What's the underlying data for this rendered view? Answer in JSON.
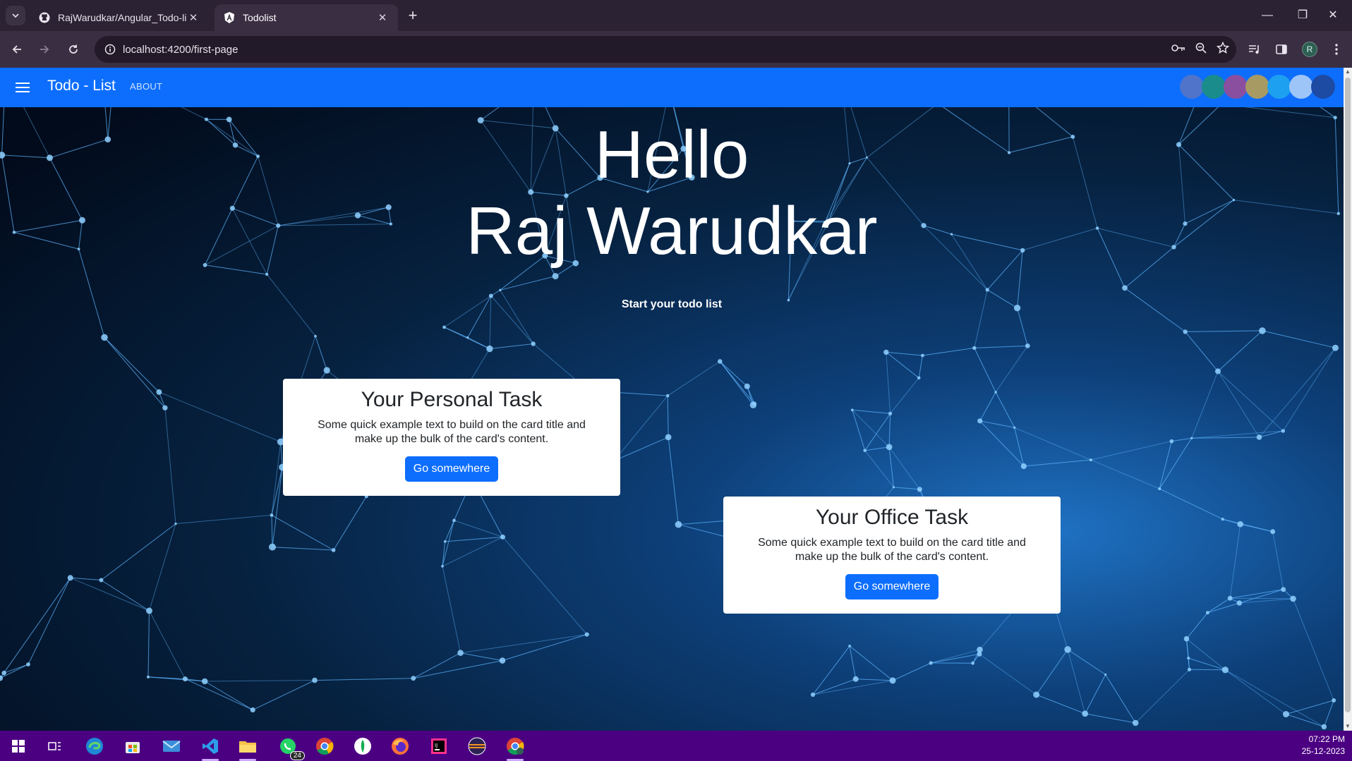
{
  "browser": {
    "tabs": [
      {
        "title": "RajWarudkar/Angular_Todo-list",
        "active": false,
        "icon": "github-icon"
      },
      {
        "title": "Todolist",
        "active": true,
        "icon": "angular-icon"
      }
    ],
    "url": "localhost:4200/first-page",
    "profile_initial": "R"
  },
  "app": {
    "brand": "Todo - List",
    "nav_about": "ABOUT",
    "theme_swatches": [
      "#4f74c9",
      "#1a8c8c",
      "#8a4f9e",
      "#a89a63",
      "#1ea0f0",
      "#9ec5f8",
      "#1d4aa3"
    ]
  },
  "hero": {
    "greeting": "Hello",
    "name": "Raj Warudkar",
    "subtitle": "Start your todo list"
  },
  "cards": [
    {
      "title": "Your Personal Task",
      "text": "Some quick example text to build on the card title and make up the bulk of the card's content.",
      "button": "Go somewhere"
    },
    {
      "title": "Your Office Task",
      "text": "Some quick example text to build on the card title and make up the bulk of the card's content.",
      "button": "Go somewhere"
    }
  ],
  "taskbar": {
    "whatsapp_badge": "24",
    "time": "07:22 PM",
    "date": "25-12-2023"
  }
}
